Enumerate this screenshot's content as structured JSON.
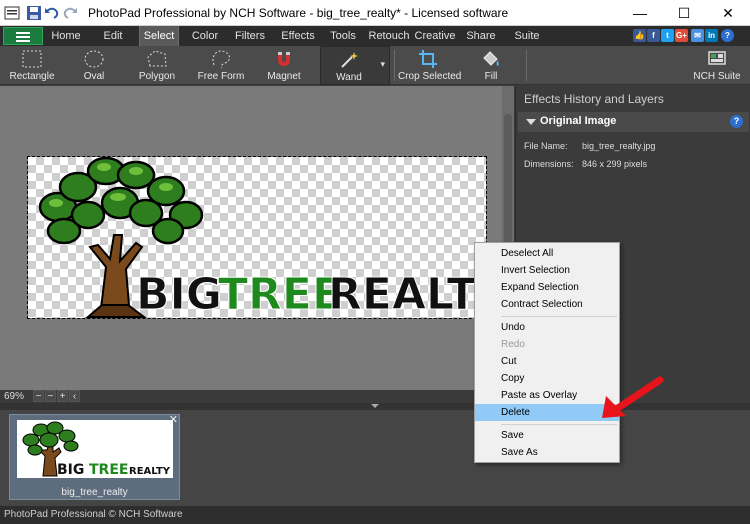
{
  "window": {
    "title": "PhotoPad Professional by NCH Software - big_tree_realty* - Licensed software",
    "controls": [
      "—",
      "☐",
      "✕"
    ]
  },
  "menu": {
    "tabs": [
      "Home",
      "Edit",
      "Select",
      "Color",
      "Filters",
      "Effects",
      "Tools",
      "Retouch",
      "Creative",
      "Share",
      "Suite"
    ],
    "active": "Select",
    "social": [
      "👍",
      "f",
      "t",
      "G+",
      "✉",
      "in",
      "?"
    ]
  },
  "toolbar": {
    "tools": [
      "Rectangle",
      "Oval",
      "Polygon",
      "Free Form",
      "Magnet",
      "Wand",
      "Crop Selected",
      "Fill"
    ],
    "suite": "NCH Suite",
    "wand_arrow": "▾"
  },
  "image": {
    "logo_parts": [
      "BIG",
      "TREE",
      "REALTY"
    ]
  },
  "zoom": {
    "level": "69%",
    "buttons": [
      "−",
      "−",
      "+",
      "‹"
    ]
  },
  "panel": {
    "header": "Effects History and Layers",
    "section_title": "Original Image",
    "help": "?",
    "file_name_label": "File Name:",
    "file_name": "big_tree_realty.jpg",
    "dimensions_label": "Dimensions:",
    "dimensions": "846 x 299 pixels"
  },
  "filmstrip": {
    "thumb_name": "big_tree_realty",
    "close": "✕",
    "thumb_logo": [
      "BIG",
      "TREE",
      "REALTY"
    ]
  },
  "status": {
    "text": "PhotoPad Professional © NCH Software"
  },
  "context_menu": {
    "items": [
      {
        "label": "Deselect All",
        "enabled": true
      },
      {
        "label": "Invert Selection",
        "enabled": true
      },
      {
        "label": "Expand Selection",
        "enabled": true
      },
      {
        "label": "Contract Selection",
        "enabled": true
      },
      {
        "label": "Undo",
        "enabled": true
      },
      {
        "label": "Redo",
        "enabled": false
      },
      {
        "label": "Cut",
        "enabled": true
      },
      {
        "label": "Copy",
        "enabled": true
      },
      {
        "label": "Paste as Overlay",
        "enabled": true
      },
      {
        "label": "Delete",
        "enabled": true,
        "highlighted": true
      },
      {
        "label": "Save",
        "enabled": true
      },
      {
        "label": "Save As",
        "enabled": true
      }
    ]
  },
  "colors": {
    "accent_green": "#1c7b3e",
    "tree_green": "#2e7d1e",
    "trunk_brown": "#7a4a1c",
    "highlight": "#91c9f7",
    "arrow_red": "#e8141c"
  }
}
